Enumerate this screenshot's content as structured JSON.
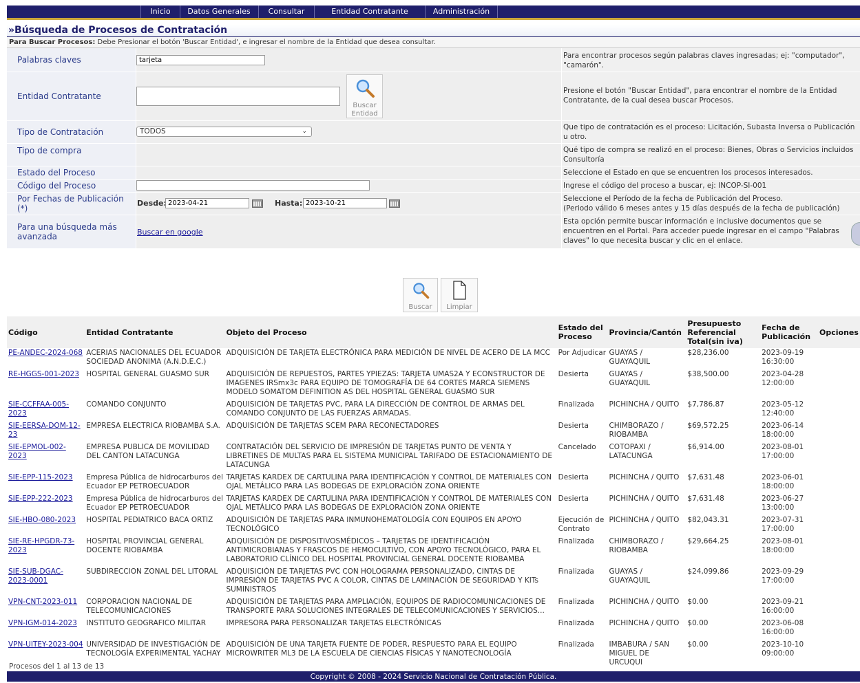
{
  "nav": {
    "items": [
      "Inicio",
      "Datos Generales",
      "Consultar",
      "Entidad Contratante",
      "Administración"
    ]
  },
  "page_title": "»Búsqueda de Procesos de Contratación",
  "hint": {
    "bold": "Para Buscar Procesos:",
    "text": " Debe Presionar el botón 'Buscar Entidad', e ingresar el nombre de la Entidad que desea consultar."
  },
  "form": {
    "keywords": {
      "label": "Palabras claves",
      "value": "tarjeta",
      "help": "Para encontrar procesos según palabras claves ingresadas; ej: \"computador\", \"camarón\"."
    },
    "entity": {
      "label": "Entidad Contratante",
      "button_line1": "Buscar",
      "button_line2": "Entidad",
      "help": "Presione el botón \"Buscar Entidad\", para encontrar el nombre de la Entidad Contratante, de la cual desea buscar Procesos."
    },
    "contract_type": {
      "label": "Tipo de Contratación",
      "value": "TODOS",
      "help": "Que tipo de contratación es el proceso: Licitación, Subasta Inversa o Publicación u otro."
    },
    "purchase_type": {
      "label": "Tipo de compra",
      "help": "Qué tipo de compra se realizó en el proceso: Bienes, Obras o Servicios incluidos Consultoría"
    },
    "status": {
      "label": "Estado del Proceso",
      "help": "Seleccione el Estado en que se encuentren los procesos interesados."
    },
    "code": {
      "label": "Código del Proceso",
      "value": "",
      "help": "Ingrese el código del proceso a buscar, ej: INCOP-SI-001"
    },
    "dates": {
      "label": "Por Fechas de Publicación (*)",
      "from_label": "Desde:",
      "from_value": "2023-04-21",
      "to_label": "Hasta:",
      "to_value": "2023-10-21",
      "help": "Seleccione el Período de la fecha de Publicación del Proceso.\n(Periodo válido 6 meses antes y 15 días después de la fecha de publicación)"
    },
    "advanced": {
      "label": "Para una búsqueda más avanzada",
      "link": "Buscar en google",
      "help": "Esta opción permite buscar información e inclusive documentos que se encuentren en el Portal. Para acceder puede ingresar en el campo \"Palabras claves\" lo que necesita buscar y clic en el enlace."
    }
  },
  "actions": {
    "search": "Buscar",
    "clear": "Limpiar"
  },
  "table": {
    "headers": [
      "Código",
      "Entidad Contratante",
      "Objeto del Proceso",
      "Estado del Proceso",
      "Provincia/Cantón",
      "Presupuesto Referencial Total(sin iva)",
      "Fecha de Publicación",
      "Opciones"
    ],
    "rows": [
      [
        "PE-ANDEC-2024-068",
        "ACERIAS NACIONALES DEL ECUADOR SOCIEDAD ANONIMA (A.N.D.E.C.)",
        "ADQUISICIÓN DE TARJETA ELECTRÓNICA PARA MEDICIÓN DE NIVEL DE ACERO DE LA MCC",
        "Por Adjudicar",
        "GUAYAS / GUAYAQUIL",
        "$28,236.00",
        "2023-09-19 16:30:00"
      ],
      [
        "RE-HGGS-001-2023",
        "HOSPITAL GENERAL GUASMO SUR",
        "ADQUISICIÓN DE REPUESTOS, PARTES YPIEZAS: TARJETA UMAS2A Y ECONSTRUCTOR DE IMAGENES IRSmx3c PARA EQUIPO DE TOMOGRAFÍA DE 64 CORTES MARCA SIEMENS MODELO SOMATOM DEFINITION AS DEL HOSPITAL GENERAL GUASMO SUR",
        "Desierta",
        "GUAYAS / GUAYAQUIL",
        "$38,500.00",
        "2023-04-28 12:00:00"
      ],
      [
        "SIE-CCFFAA-005-2023",
        "COMANDO CONJUNTO",
        "ADQUISICIÓN DE TARJETAS PVC, PARA LA DIRECCIÓN DE CONTROL DE ARMAS DEL COMANDO CONJUNTO DE LAS FUERZAS ARMADAS.",
        "Finalizada",
        "PICHINCHA / QUITO",
        "$7,786.87",
        "2023-05-12 12:40:00"
      ],
      [
        "SIE-EERSA-DOM-12-23",
        "EMPRESA ELECTRICA RIOBAMBA S.A.",
        "ADQUISICIÓN DE TARJETAS SCEM PARA RECONECTADORES",
        "Desierta",
        "CHIMBORAZO / RIOBAMBA",
        "$69,572.25",
        "2023-06-14 18:00:00"
      ],
      [
        "SIE-EPMOL-002-2023",
        "EMPRESA PUBLICA DE MOVILIDAD DEL CANTON LATACUNGA",
        "CONTRATACIÓN DEL SERVICIO DE IMPRESIÓN DE TARJETAS PUNTO DE VENTA Y LIBRETINES DE MULTAS PARA EL SISTEMA MUNICIPAL TARIFADO DE ESTACIONAMIENTO DE LATACUNGA",
        "Cancelado",
        "COTOPAXI / LATACUNGA",
        "$6,914.00",
        "2023-08-01 17:00:00"
      ],
      [
        "SIE-EPP-115-2023",
        "Empresa Pública de hidrocarburos del Ecuador EP PETROECUADOR",
        "TARJETAS KARDEX DE CARTULINA PARA IDENTIFICACIÓN Y CONTROL DE MATERIALES CON OJAL METÁLICO PARA LAS BODEGAS DE EXPLORACIÓN ZONA ORIENTE",
        "Desierta",
        "PICHINCHA / QUITO",
        "$7,631.48",
        "2023-06-01 18:00:00"
      ],
      [
        "SIE-EPP-222-2023",
        "Empresa Pública de hidrocarburos del Ecuador EP PETROECUADOR",
        "TARJETAS KARDEX DE CARTULINA PARA IDENTIFICACIÓN Y CONTROL DE MATERIALES CON OJAL METÁLICO PARA LAS BODEGAS DE EXPLORACIÓN ZONA ORIENTE",
        "Desierta",
        "PICHINCHA / QUITO",
        "$7,631.48",
        "2023-06-27 13:00:00"
      ],
      [
        "SIE-HBO-080-2023",
        "HOSPITAL PEDIATRICO BACA ORTIZ",
        "ADQUISICIÓN DE TARJETAS PARA INMUNOHEMATOLOGÍA CON EQUIPOS EN APOYO TECNOLÓGICO",
        "Ejecución de Contrato",
        "PICHINCHA / QUITO",
        "$82,043.31",
        "2023-07-31 17:00:00"
      ],
      [
        "SIE-RE-HPGDR-73-2023",
        "HOSPITAL PROVINCIAL GENERAL DOCENTE RIOBAMBA",
        "ADQUISICIÓN DE DISPOSITIVOSMÉDICOS – TARJETAS DE IDENTIFICACIÓN ANTIMICROBIANAS Y FRASCOS DE HEMOCULTIVO, CON APOYO TECNOLÓGICO, PARA EL LABORATORIO CLÍNICO DEL HOSPITAL PROVINCIAL GENERAL DOCENTE RIOBAMBA",
        "Finalizada",
        "CHIMBORAZO / RIOBAMBA",
        "$29,664.25",
        "2023-08-01 18:00:00"
      ],
      [
        "SIE-SUB-DGAC-2023-0001",
        "SUBDIRECCION ZONAL DEL LITORAL",
        "ADQUISICIÓN DE TARJETAS PVC CON HOLOGRAMA PERSONALIZADO, CINTAS DE IMPRESIÓN DE TARJETAS PVC A COLOR, CINTAS DE LAMINACIÓN DE SEGURIDAD Y KITs SUMINISTROS",
        "Finalizada",
        "GUAYAS / GUAYAQUIL",
        "$24,099.86",
        "2023-09-29 17:00:00"
      ],
      [
        "VPN-CNT-2023-011",
        "CORPORACION NACIONAL DE TELECOMUNICACIONES",
        "ADQUISICIÓN DE TARJETAS PARA AMPLIACIÓN, EQUIPOS DE RADIOCOMUNICACIONES DE TRANSPORTE PARA SOLUCIONES INTEGRALES DE TELECOMUNICACIONES Y SERVICIOS...",
        "Finalizada",
        "PICHINCHA / QUITO",
        "$0.00",
        "2023-09-21 16:00:00"
      ],
      [
        "VPN-IGM-014-2023",
        "INSTITUTO GEOGRAFICO MILITAR",
        "IMPRESORA PARA PERSONALIZAR TARJETAS ELECTRÓNICAS",
        "Finalizada",
        "PICHINCHA / QUITO",
        "$0.00",
        "2023-06-08 16:00:00"
      ],
      [
        "VPN-UITEY-2023-004",
        "UNIVERSIDAD DE INVESTIGACIÓN DE TECNOLOGÍA EXPERIMENTAL YACHAY",
        "ADQUISICIÓN DE UNA TARJETA FUENTE DE PODER, RESPUESTO PARA EL EQUIPO MICROWRITER ML3 DE LA ESCUELA DE CIENCIAS FÍSICAS Y NANOTECNOLOGÍA",
        "Finalizada",
        "IMBABURA / SAN MIGUEL DE URCUQUI",
        "$0.00",
        "2023-10-10 09:00:00"
      ]
    ]
  },
  "count_text": "Procesos del 1 al 13 de 13",
  "footer": "Copyright © 2008 - 2024 Servicio Nacional de Contratación Pública."
}
